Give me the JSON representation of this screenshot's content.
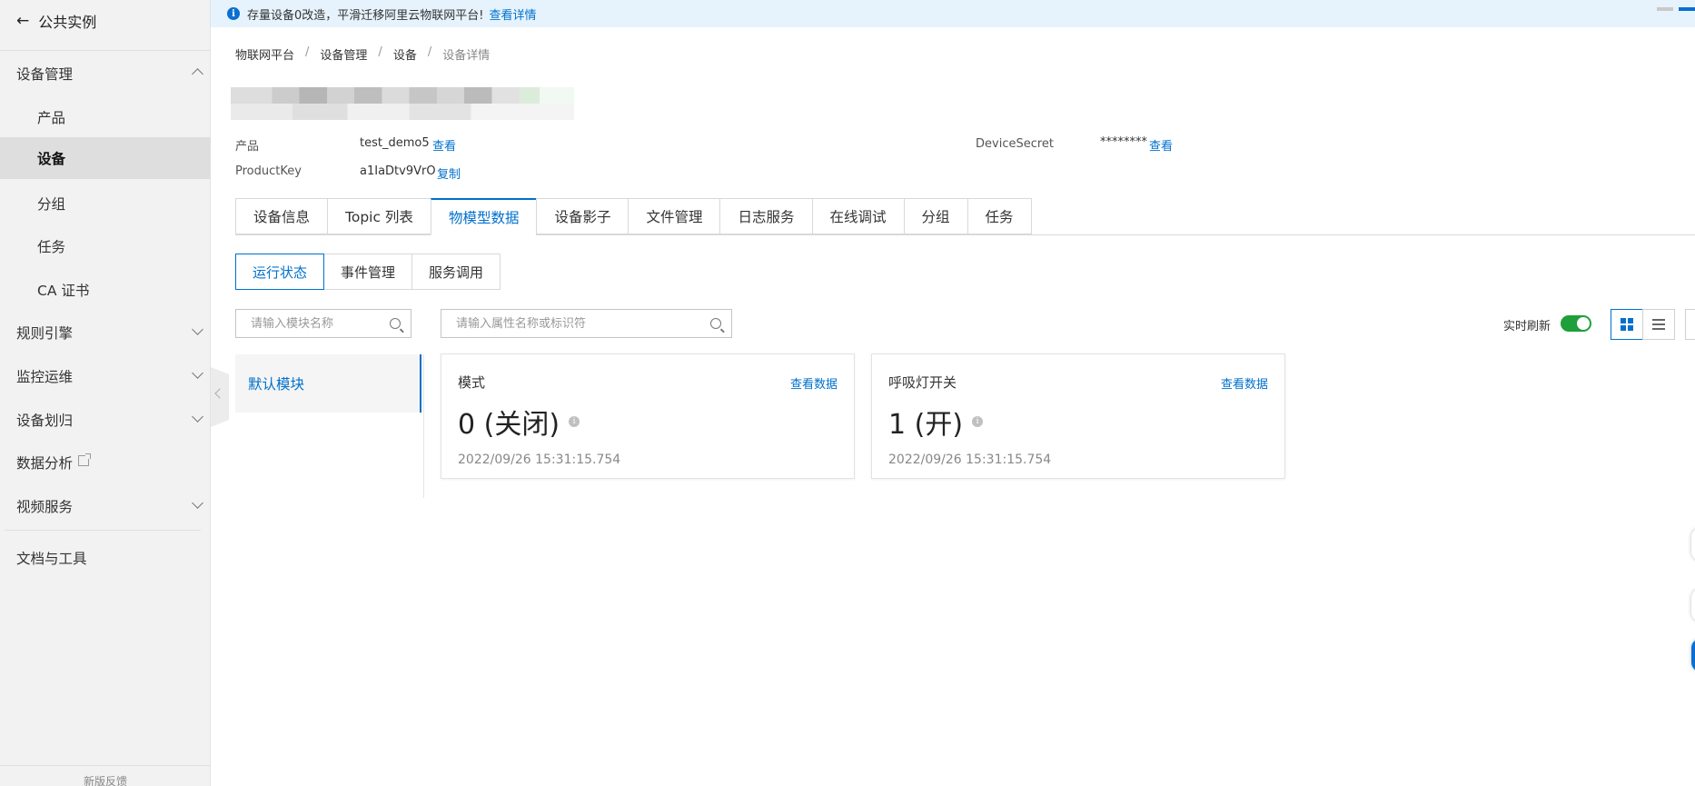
{
  "sidebar": {
    "back_label": "公共实例",
    "items": [
      {
        "label": "设备管理"
      },
      {
        "label": "产品"
      },
      {
        "label": "设备"
      },
      {
        "label": "分组"
      },
      {
        "label": "任务"
      },
      {
        "label": "CA 证书"
      },
      {
        "label": "规则引擎"
      },
      {
        "label": "监控运维"
      },
      {
        "label": "设备划归"
      },
      {
        "label": "数据分析"
      },
      {
        "label": "视频服务"
      },
      {
        "label": "文档与工具"
      }
    ],
    "feedback_label": "新版反馈"
  },
  "notice": {
    "text": "存量设备0改造，平滑迁移阿里云物联网平台!",
    "link": "查看详情"
  },
  "breadcrumb": [
    "物联网平台",
    "设备管理",
    "设备",
    "设备详情"
  ],
  "device_info": {
    "product_label": "产品",
    "product_value": "test_demo5",
    "product_link": "查看",
    "productkey_label": "ProductKey",
    "productkey_value": "a1IaDtv9VrO",
    "productkey_link": "复制",
    "secret_label": "DeviceSecret",
    "secret_value": "********",
    "secret_link": "查看"
  },
  "tabs": [
    "设备信息",
    "Topic 列表",
    "物模型数据",
    "设备影子",
    "文件管理",
    "日志服务",
    "在线调试",
    "分组",
    "任务"
  ],
  "active_tab": "物模型数据",
  "subtabs": [
    "运行状态",
    "事件管理",
    "服务调用"
  ],
  "module_search": {
    "placeholder": "请输入模块名称"
  },
  "property_search": {
    "placeholder": "请输入属性名称或标识符"
  },
  "modules": [
    {
      "label": "默认模块"
    }
  ],
  "realtime": {
    "label": "实时刷新",
    "enabled": true
  },
  "cards": [
    {
      "title": "模式",
      "link": "查看数据",
      "value": "0 (关闭)",
      "time": "2022/09/26 15:31:15.754"
    },
    {
      "title": "呼吸灯开关",
      "link": "查看数据",
      "value": "1 (开)",
      "time": "2022/09/26 15:31:15.754"
    }
  ],
  "colors": {
    "accent": "#0070cc",
    "toggle_on": "#1f9f3a",
    "notice_bg": "#e6f3fd"
  }
}
